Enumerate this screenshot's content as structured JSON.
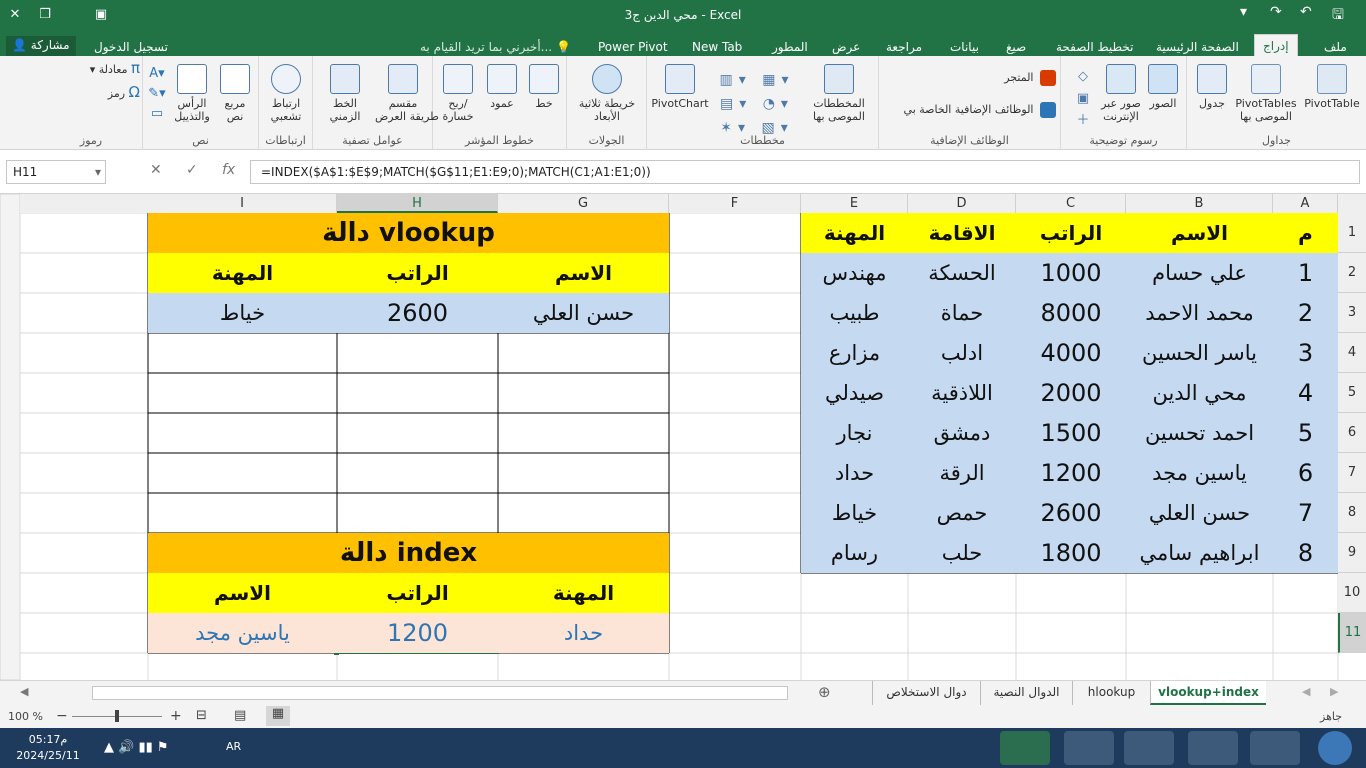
{
  "window": {
    "title": "محي الدين ج3 - Excel",
    "login": "تسجيل الدخول",
    "share": "مشاركة",
    "tellme": "أخبرني بما تريد القيام به..."
  },
  "tabs": [
    {
      "label": "ملف"
    },
    {
      "label": "إدراج"
    },
    {
      "label": "الصفحة الرئيسية"
    },
    {
      "label": "تخطيط الصفحة"
    },
    {
      "label": "صيغ"
    },
    {
      "label": "بيانات"
    },
    {
      "label": "مراجعة"
    },
    {
      "label": "عرض"
    },
    {
      "label": "المطور"
    },
    {
      "label": "New Tab"
    },
    {
      "label": "Power Pivot"
    }
  ],
  "ribbon": {
    "groups": {
      "tables": "جداول",
      "illustrations": "رسوم توضيحية",
      "addins": "الوظائف الإضافية",
      "charts": "مخططات",
      "tours": "الجولات",
      "sparklines": "خطوط المؤشر",
      "filters": "عوامل تصفية",
      "links": "ارتباطات",
      "text": "نص",
      "symbols": "رموز"
    },
    "buttons": {
      "pivottable": "PivotTable",
      "rec_pivot1": "PivotTables",
      "rec_pivot2": "الموصى بها",
      "table": "جدول",
      "pictures": "الصور",
      "online1": "صور عبر",
      "online2": "الإنترنت",
      "store": "المتجر",
      "myaddins": "الوظائف الإضافية الخاصة بي",
      "rec_charts1": "المخططات",
      "rec_charts2": "الموصى بها",
      "pivotchart": "PivotChart",
      "map1": "خريطة ثلاثية",
      "map2": "الأبعاد",
      "line": "خط",
      "column": "عمود",
      "winloss1": "ربح/",
      "winloss2": "خسارة",
      "slicer1": "مقسم",
      "slicer2": "طريقة العرض",
      "timeline1": "الخط",
      "timeline2": "الزمني",
      "hyperlink1": "ارتباط",
      "hyperlink2": "تشعبي",
      "textbox1": "مربع",
      "textbox2": "نص",
      "header1": "الرأس",
      "header2": "والتذييل",
      "equation": "معادلة",
      "symbol": "رمز"
    }
  },
  "formula_bar": {
    "name_box": "H11",
    "fx": "fx",
    "formula": "=INDEX($A$1:$E$9;MATCH($G$11;E1:E9;0);MATCH(C1;A1:E1;0))"
  },
  "columns": [
    "A",
    "B",
    "C",
    "D",
    "E",
    "F",
    "G",
    "H",
    "I"
  ],
  "rows": [
    "1",
    "2",
    "3",
    "4",
    "5",
    "6",
    "7",
    "8",
    "9",
    "10",
    "11"
  ],
  "main_table": {
    "headers": [
      "م",
      "الاسم",
      "الراتب",
      "الاقامة",
      "المهنة"
    ],
    "rows": [
      [
        "1",
        "علي حسام",
        "1000",
        "الحسكة",
        "مهندس"
      ],
      [
        "2",
        "محمد الاحمد",
        "8000",
        "حماة",
        "طبيب"
      ],
      [
        "3",
        "ياسر الحسين",
        "4000",
        "ادلب",
        "مزارع"
      ],
      [
        "4",
        "محي الدين",
        "2000",
        "اللاذقية",
        "صيدلي"
      ],
      [
        "5",
        "احمد تحسين",
        "1500",
        "دمشق",
        "نجار"
      ],
      [
        "6",
        "ياسين مجد",
        "1200",
        "الرقة",
        "حداد"
      ],
      [
        "7",
        "حسن العلي",
        "2600",
        "حمص",
        "خياط"
      ],
      [
        "8",
        "ابراهيم سامي",
        "1800",
        "حلب",
        "رسام"
      ]
    ]
  },
  "vlookup_block": {
    "title": "دالة  vlookup",
    "headers": [
      "الاسم",
      "الراتب",
      "المهنة"
    ],
    "values": [
      "حسن العلي",
      "2600",
      "خياط"
    ]
  },
  "index_block": {
    "title": "دالة index",
    "headers": [
      "المهنة",
      "الراتب",
      "الاسم"
    ],
    "values": [
      "حداد",
      "1200",
      "ياسين مجد"
    ]
  },
  "sheets": [
    {
      "label": "vlookup+index",
      "active": true
    },
    {
      "label": "hlookup",
      "active": false
    },
    {
      "label": "الدوال النصية",
      "active": false
    },
    {
      "label": "دوال الاستخلاص",
      "active": false
    }
  ],
  "status": {
    "ready": "جاهز",
    "zoom": "100 %"
  },
  "taskbar": {
    "time": "05:17م",
    "date": "2024/25/11",
    "lang": "AR"
  },
  "colors": {
    "excel_green": "#217346",
    "header_yellow": "#ffff00",
    "title_orange": "#ffc000",
    "data_blue": "#c5d9f1",
    "result_peach": "#fce4d6",
    "result_text": "#2e75b6"
  }
}
